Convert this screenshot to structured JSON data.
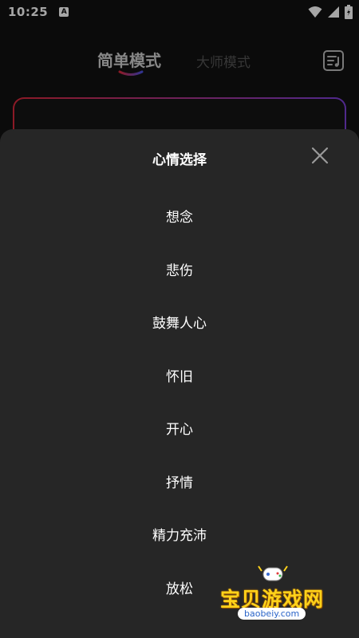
{
  "status_bar": {
    "time": "10:25",
    "badge": "A"
  },
  "header": {
    "tab_simple": "简单模式",
    "tab_master": "大师模式"
  },
  "sheet": {
    "title": "心情选择",
    "moods": [
      "想念",
      "悲伤",
      "鼓舞人心",
      "怀旧",
      "开心",
      "抒情",
      "精力充沛",
      "放松"
    ]
  },
  "watermark": {
    "title": "宝贝游戏网",
    "url": "baobeiy.com"
  },
  "colors": {
    "sheet_bg": "#262626",
    "card_gradient_start": "#d8283a",
    "card_gradient_end": "#7b3fd8",
    "watermark_yellow": "#ffd21a"
  },
  "icons": [
    "wifi-icon",
    "signal-icon",
    "battery-icon",
    "playlist-icon",
    "close-icon"
  ]
}
